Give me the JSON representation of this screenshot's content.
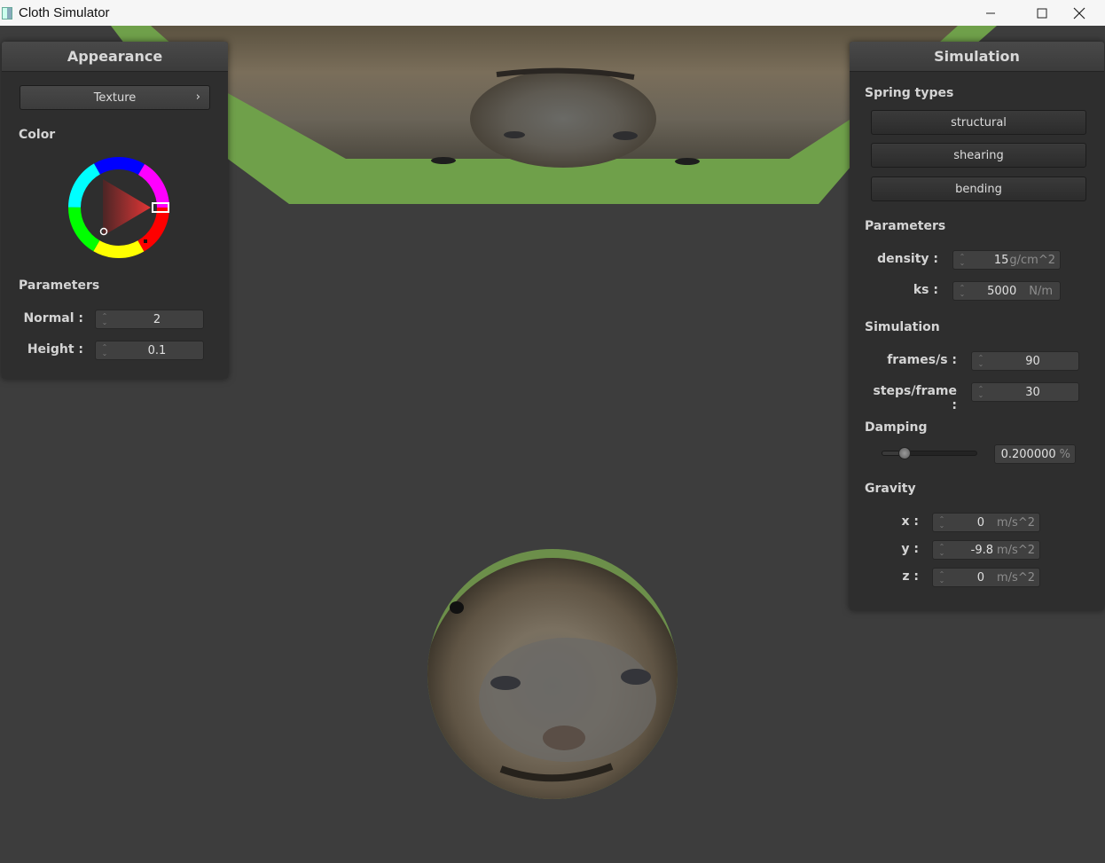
{
  "window": {
    "title": "Cloth Simulator",
    "minimize_icon": "minimize-icon",
    "maximize_icon": "maximize-icon",
    "close_icon": "close-icon"
  },
  "appearance": {
    "title": "Appearance",
    "texture_button": "Texture",
    "chevron_glyph": "›",
    "color_label": "Color",
    "color_value": "#e02222",
    "parameters_label": "Parameters",
    "normal_label": "Normal :",
    "normal_value": "2",
    "height_label": "Height :",
    "height_value": "0.1"
  },
  "simulation": {
    "title": "Simulation",
    "spring_types_label": "Spring types",
    "spring_buttons": [
      "structural",
      "shearing",
      "bending"
    ],
    "parameters_label": "Parameters",
    "density_label": "density :",
    "density_value": "15",
    "density_unit": "g/cm^2",
    "ks_label": "ks :",
    "ks_value": "5000",
    "ks_unit": "N/m",
    "simulation_label": "Simulation",
    "fps_label": "frames/s :",
    "fps_value": "90",
    "steps_label": "steps/frame :",
    "steps_value": "30",
    "damping_label": "Damping",
    "damping_value": "0.200000",
    "damping_unit": "%",
    "damping_slider_fraction": 0.2,
    "gravity_label": "Gravity",
    "gx_label": "x :",
    "gx_value": "0",
    "gy_label": "y :",
    "gy_value": "-9.8",
    "gz_label": "z :",
    "gz_value": "0",
    "gravity_unit": "m/s^2"
  },
  "spin_glyph_up": "⌃",
  "spin_glyph_down": "⌄"
}
